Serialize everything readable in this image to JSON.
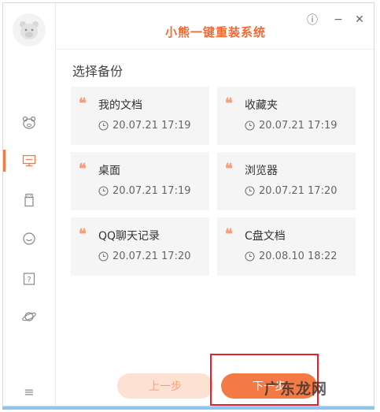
{
  "app": {
    "title": "小熊一键重装系统"
  },
  "window_controls": {
    "info_icon": "ⓘ",
    "minimize": "−",
    "close": "✕"
  },
  "sidebar": {
    "items": [
      {
        "name": "bear-face-icon",
        "active": false
      },
      {
        "name": "monitor-icon",
        "active": true
      },
      {
        "name": "usb-drive-icon",
        "active": false
      },
      {
        "name": "chat-bubble-icon",
        "active": false
      },
      {
        "name": "help-icon",
        "active": false
      },
      {
        "name": "planet-icon",
        "active": false
      }
    ],
    "menu_icon": "≡"
  },
  "main": {
    "section_title": "选择备份",
    "backups": [
      {
        "name": "我的文档",
        "time": "20.07.21 17:19"
      },
      {
        "name": "收藏夹",
        "time": "20.07.21 17:19"
      },
      {
        "name": "桌面",
        "time": "20.07.21 17:19"
      },
      {
        "name": "浏览器",
        "time": "20.07.21 17:20"
      },
      {
        "name": "QQ聊天记录",
        "time": "20.07.21 17:20"
      },
      {
        "name": "C盘文档",
        "time": "20.08.10 18:22"
      }
    ]
  },
  "footer": {
    "prev_label": "上一步",
    "next_label": "下一步"
  },
  "watermark": "广东龙网",
  "colors": {
    "accent": "#f47a45",
    "title": "#f06a35",
    "highlight": "#e8202a"
  }
}
